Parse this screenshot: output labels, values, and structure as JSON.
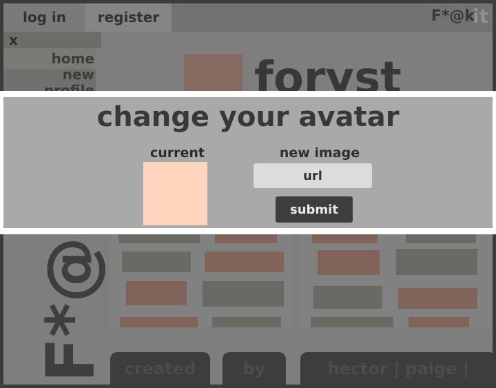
{
  "nav": {
    "login": "log in",
    "register": "register"
  },
  "brand": {
    "text": "F*@k",
    "suffix": "it"
  },
  "sidebar": {
    "close": "x",
    "items": [
      "home",
      "new",
      "profile"
    ]
  },
  "profile": {
    "name": "foryst"
  },
  "vertical_logo": "F*@k",
  "modal": {
    "title": "change your avatar",
    "current_label": "current",
    "new_label": "new image",
    "url_placeholder": "url",
    "submit_label": "submit",
    "avatar_color": "#ffd5bd"
  },
  "footer": {
    "created": "created",
    "by": "by",
    "names": "hector | paige | foryst"
  }
}
